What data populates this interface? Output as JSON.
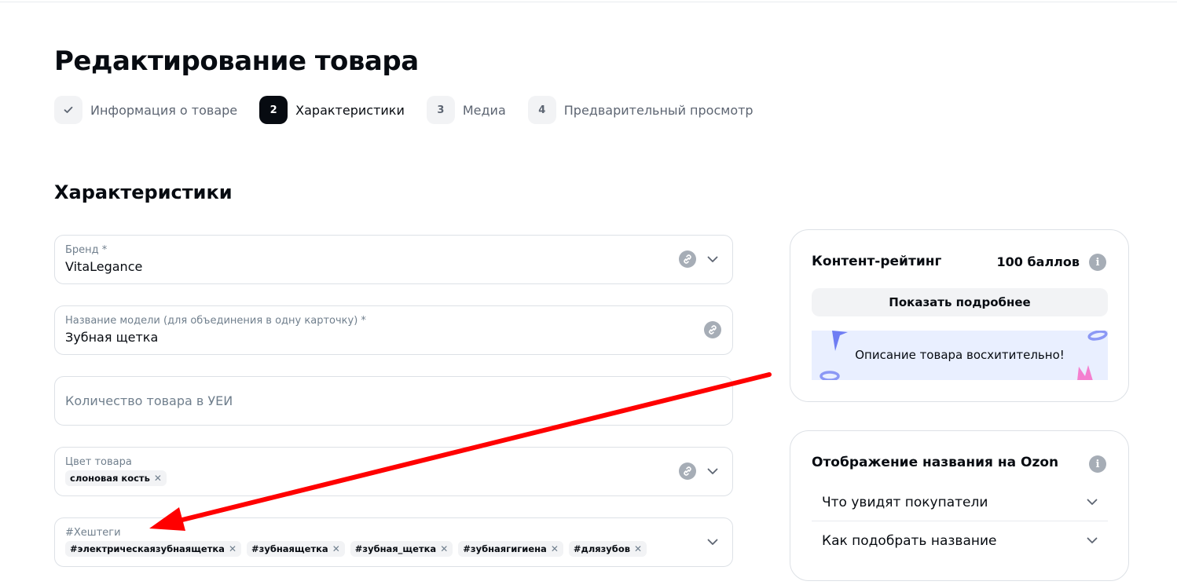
{
  "page_title": "Редактирование товара",
  "steps": [
    {
      "badge": "✓",
      "label": "Информация о товаре",
      "state": "done"
    },
    {
      "badge": "2",
      "label": "Характеристики",
      "state": "active"
    },
    {
      "badge": "3",
      "label": "Медиа",
      "state": "pending"
    },
    {
      "badge": "4",
      "label": "Предварительный просмотр",
      "state": "pending"
    }
  ],
  "section_title": "Характеристики",
  "fields": {
    "brand": {
      "label": "Бренд *",
      "value": "VitaLegance"
    },
    "model": {
      "label": "Название модели (для объединения в одну карточку) *",
      "value": "Зубная щетка"
    },
    "quantity": {
      "placeholder": "Количество товара в УЕИ"
    },
    "color": {
      "label": "Цвет товара",
      "chips": [
        "слоновая кость"
      ]
    },
    "hashtags": {
      "label": "#Хештеги",
      "chips": [
        "#электрическаязубнаящетка",
        "#зубнаящетка",
        "#зубная_щетка",
        "#зубнаягигиена",
        "#длязубов"
      ]
    }
  },
  "rating_card": {
    "title": "Контент-рейтинг",
    "score": "100 баллов",
    "button": "Показать подробнее",
    "banner": "Описание товара восхитительно!"
  },
  "display_card": {
    "title": "Отображение названия на Ozon",
    "items": [
      "Что увидят покупатели",
      "Как подобрать название"
    ]
  },
  "colors": {
    "accent_dark": "#070b11",
    "muted_text": "#707f8d",
    "chip_bg": "#f2f3f5",
    "border": "#dde1e6",
    "banner_bg": "#e9efff",
    "annotation_arrow": "#ff0000"
  }
}
